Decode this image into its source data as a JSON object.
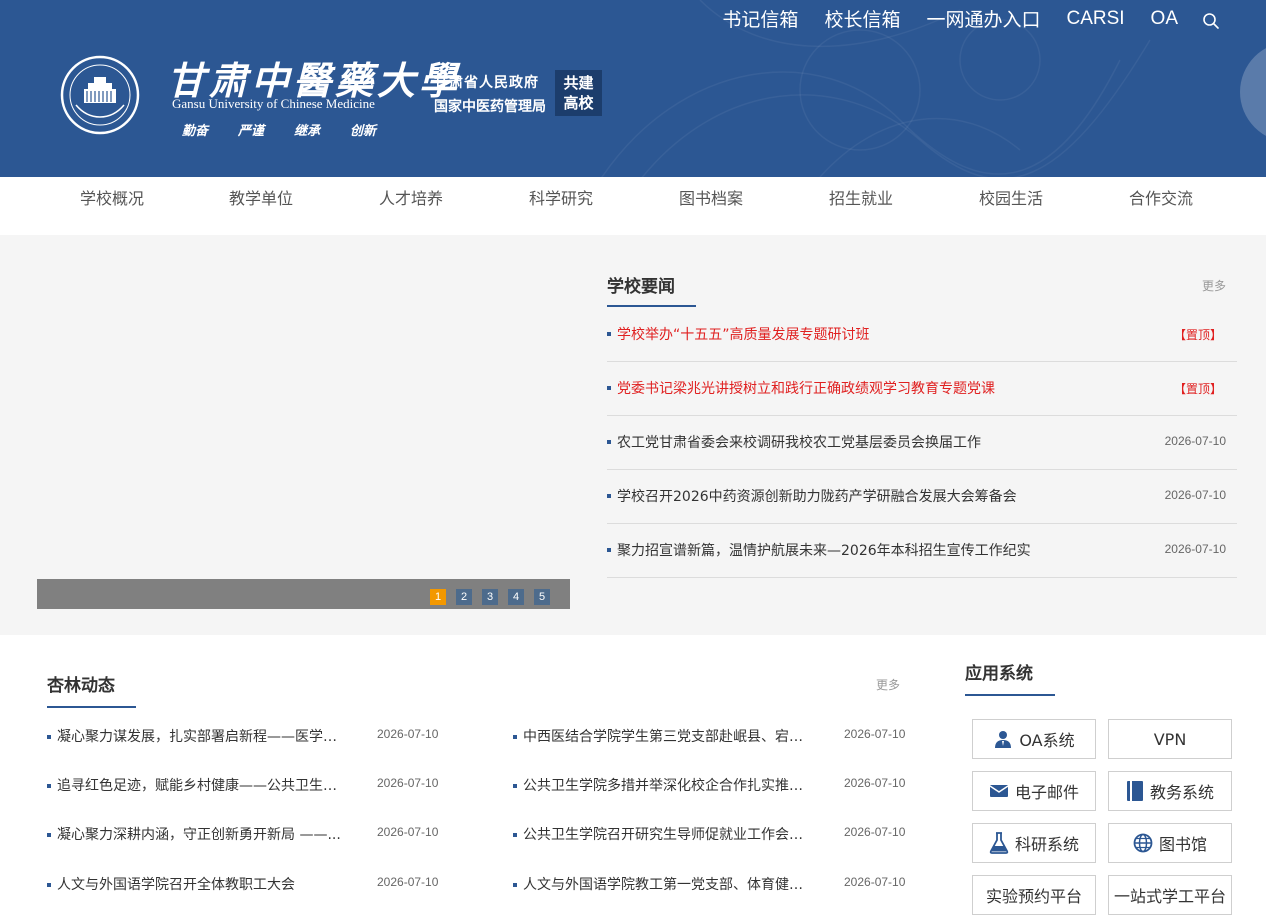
{
  "header": {
    "top_links": [
      "书记信箱",
      "校长信箱",
      "一网通办入口",
      "CARSI",
      "OA"
    ],
    "school_name_cn": "甘肃中醫藥大學",
    "school_name_en": "Gansu University of Chinese Medicine",
    "motto": [
      "勤奋",
      "严谨",
      "继承",
      "创新"
    ],
    "gov_line1": "甘肃省人民政府",
    "gov_line2": "国家中医药管理局",
    "gongjian": "共建高校",
    "gongjian_l1": "共建",
    "gongjian_l2": "高校",
    "colors": {
      "header_bg": "#2c5793",
      "accent": "#f39800",
      "pin_red": "#e02020"
    }
  },
  "nav": {
    "items": [
      "学校概况",
      "教学单位",
      "人才培养",
      "科学研究",
      "图书档案",
      "招生就业",
      "校园生活",
      "合作交流"
    ]
  },
  "slider": {
    "pages": [
      "1",
      "2",
      "3",
      "4",
      "5"
    ],
    "active_page": "1"
  },
  "school_news": {
    "title": "学校要闻",
    "more": "更多",
    "items": [
      {
        "text": "学校举办“十五五”高质量发展专题研讨班",
        "tag": "【置顶】",
        "date": ""
      },
      {
        "text": "党委书记梁兆光讲授树立和践行正确政绩观学习教育专题党课",
        "tag": "【置顶】",
        "date": ""
      },
      {
        "text": "农工党甘肃省委会来校调研我校农工党基层委员会换届工作",
        "tag": "",
        "date": "2026-07-10"
      },
      {
        "text": "学校召开2026中药资源创新助力陇药产学研融合发展大会筹备会",
        "tag": "",
        "date": "2026-07-10"
      },
      {
        "text": "聚力招宣谱新篇，温情护航展未来—2026年本科招生宣传工作纪实",
        "tag": "",
        "date": "2026-07-10"
      }
    ]
  },
  "xinglin": {
    "title": "杏林动态",
    "more": "更多",
    "left": [
      {
        "text": "凝心聚力谋发展，扎实部署启新程——医学信...",
        "date": "2026-07-10"
      },
      {
        "text": "追寻红色足迹，赋能乡村健康——公共卫生学...",
        "date": "2026-07-10"
      },
      {
        "text": "凝心聚力深耕内涵，守正创新勇开新局 ——...",
        "date": "2026-07-10"
      },
      {
        "text": "人文与外国语学院召开全体教职工大会",
        "date": "2026-07-10"
      }
    ],
    "right": [
      {
        "text": "中西医结合学院学生第三党支部赴岷县、宕昌...",
        "date": "2026-07-10"
      },
      {
        "text": "公共卫生学院多措并举深化校企合作扎实推进...",
        "date": "2026-07-10"
      },
      {
        "text": "公共卫生学院召开研究生导师促就业工作会议...",
        "date": "2026-07-10"
      },
      {
        "text": "人文与外国语学院教工第一党支部、体育健康...",
        "date": "2026-07-10"
      }
    ]
  },
  "apps": {
    "title": "应用系统",
    "items": [
      {
        "label": "OA系统",
        "icon": "person-icon"
      },
      {
        "label": "VPN",
        "icon": ""
      },
      {
        "label": "电子邮件",
        "icon": "mail-icon"
      },
      {
        "label": "教务系统",
        "icon": "book-icon"
      },
      {
        "label": "科研系统",
        "icon": "flask-icon"
      },
      {
        "label": "图书馆",
        "icon": "globe-icon"
      },
      {
        "label": "实验预约平台",
        "icon": ""
      },
      {
        "label": "一站式学工平台",
        "icon": ""
      }
    ]
  }
}
